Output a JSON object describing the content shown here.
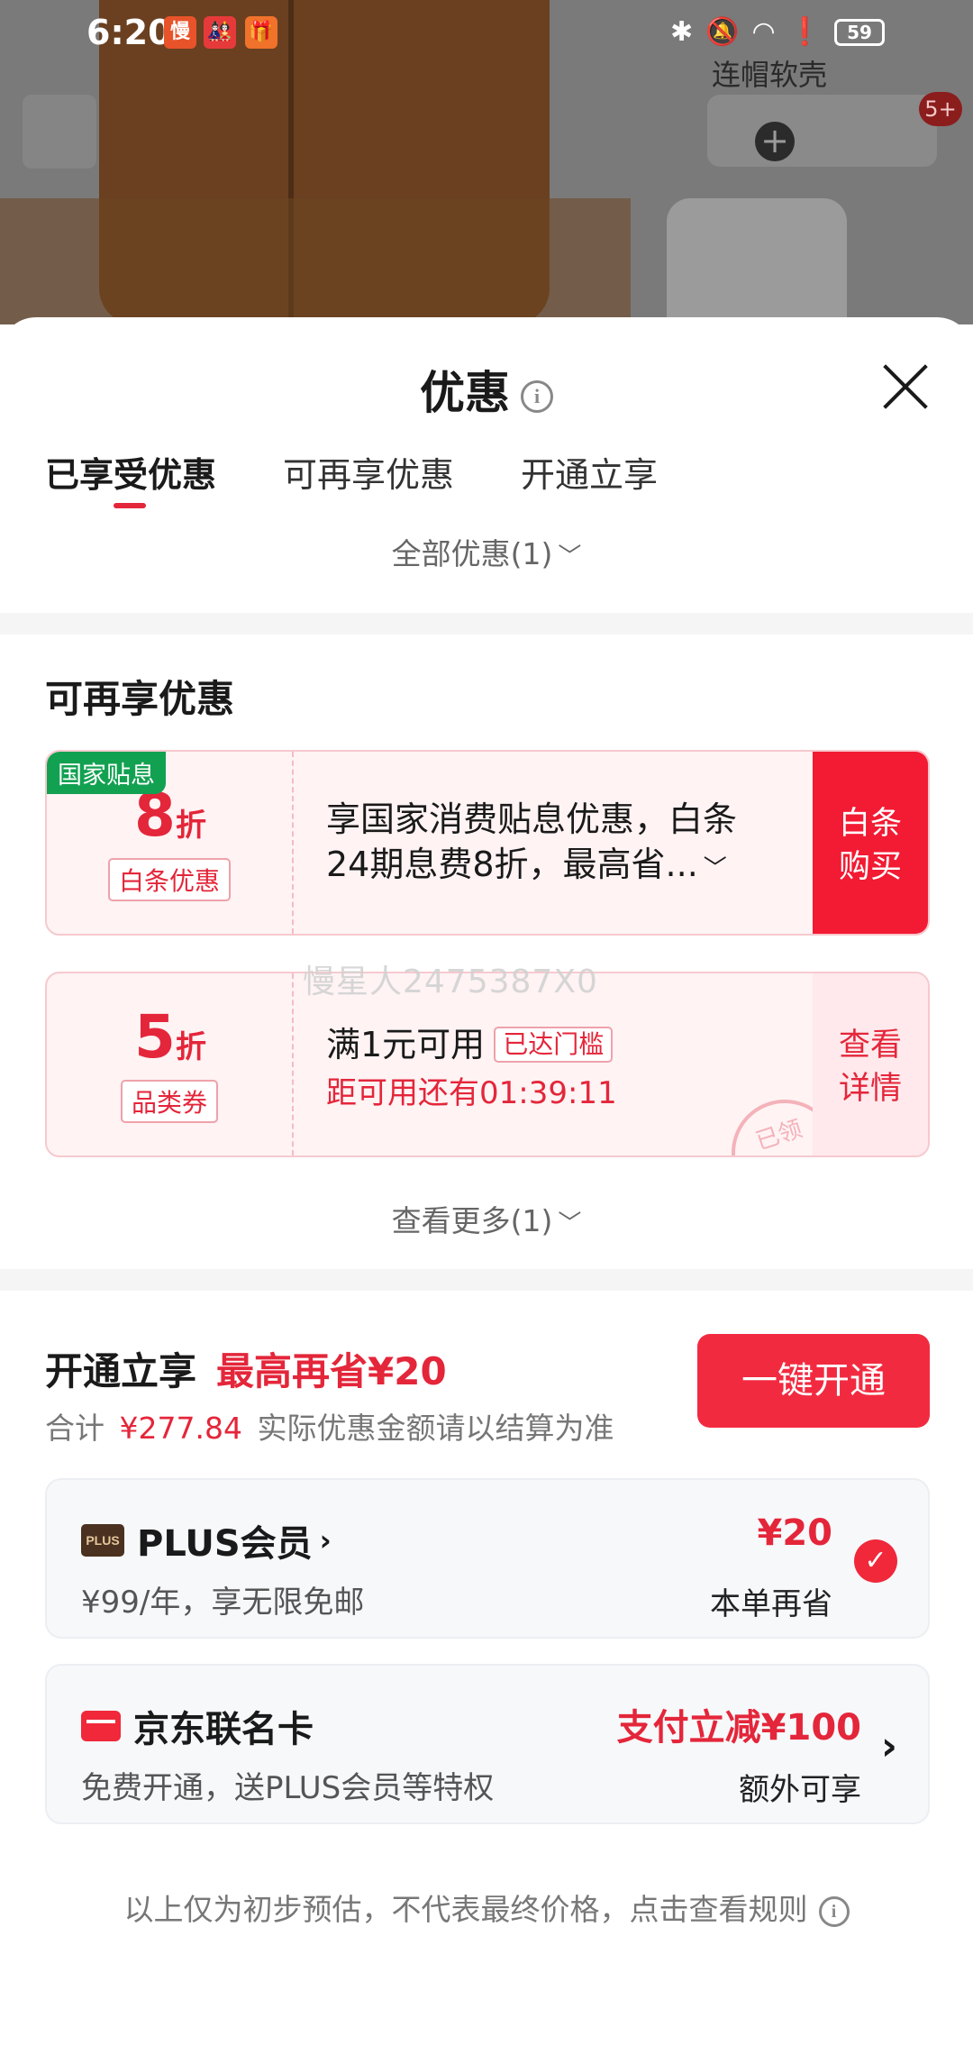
{
  "status_bar": {
    "time": "6:20",
    "notif_icons": [
      "慢",
      "🎎",
      "🎁"
    ],
    "battery": "59"
  },
  "background": {
    "product_label": "连帽软壳",
    "badge": "5+",
    "plus_symbol": "+"
  },
  "sheet": {
    "title": "优惠",
    "tabs": [
      {
        "label": "已享受优惠",
        "active": true
      },
      {
        "label": "可再享优惠",
        "active": false
      },
      {
        "label": "开通立享",
        "active": false
      }
    ],
    "all_toggle": "全部优惠(1)"
  },
  "reclaim_section": {
    "title": "可再享优惠",
    "coupons": [
      {
        "corner": "国家贴息",
        "discount": "8",
        "unit": "折",
        "tag": "白条优惠",
        "text_line1": "享国家消费贴息优惠，白条",
        "text_line2": "24期息费8折，最高省...",
        "action": "白条\n购买"
      },
      {
        "discount": "5",
        "unit": "折",
        "tag": "品类券",
        "text_line1": "满1元可用",
        "pill": "已达门槛",
        "countdown": "距可用还有01:39:11",
        "action": "查看\n详情",
        "stamp": "已领"
      }
    ],
    "watermark": "慢星人2475387X0",
    "more_toggle": "查看更多(1)"
  },
  "open_section": {
    "title": "开通立享",
    "save_text": "最高再省¥20",
    "total_prefix": "合计",
    "total_amount": "¥277.84",
    "total_suffix": "实际优惠金额请以结算为准",
    "button": "一键开通",
    "plus": {
      "logo": "PLUS",
      "name": "PLUS会员",
      "desc": "¥99/年，享无限免邮",
      "amount": "¥20",
      "amount_note": "本单再省"
    },
    "card": {
      "name": "京东联名卡",
      "desc": "免费开通，送PLUS会员等特权",
      "amount": "支付立减¥100",
      "amount_note": "额外可享"
    }
  },
  "footer": {
    "note": "以上仅为初步预估，不代表最终价格，点击查看规则"
  },
  "colors": {
    "accent": "#e4263a",
    "button_red": "#f22a40",
    "green_tag": "#12a151"
  }
}
